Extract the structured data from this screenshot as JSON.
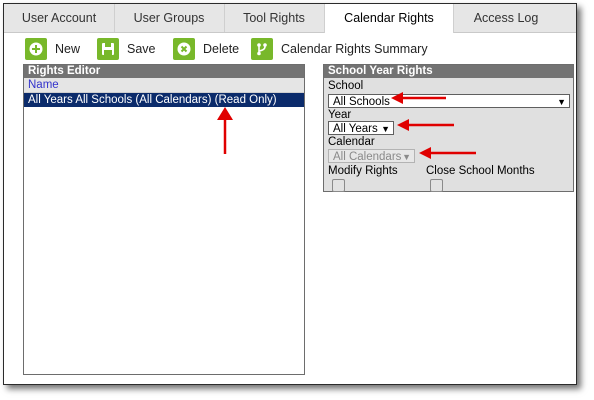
{
  "tabs": [
    {
      "label": "User Account"
    },
    {
      "label": "User Groups"
    },
    {
      "label": "Tool Rights"
    },
    {
      "label": "Calendar Rights"
    },
    {
      "label": "Access Log"
    }
  ],
  "toolbar": {
    "new_label": "New",
    "save_label": "Save",
    "delete_label": "Delete",
    "summary_label": "Calendar Rights Summary"
  },
  "rights_editor": {
    "title": "Rights Editor",
    "column_name": "Name",
    "rows": [
      {
        "name": "All Years All Schools (All Calendars) (Read Only)"
      }
    ]
  },
  "school_year_rights": {
    "title": "School Year Rights",
    "school_label": "School",
    "school_value": "All Schools",
    "year_label": "Year",
    "year_value": "All Years",
    "calendar_label": "Calendar",
    "calendar_value": "All Calendars",
    "modify_rights_label": "Modify Rights",
    "close_school_months_label": "Close School Months"
  },
  "colors": {
    "accent_green": "#78b82a",
    "selected_row": "#0b2b6b",
    "annotation_red": "#e00000"
  },
  "icons": [
    "plus-icon",
    "save-icon",
    "delete-icon",
    "branch-icon",
    "caret-down-icon"
  ]
}
